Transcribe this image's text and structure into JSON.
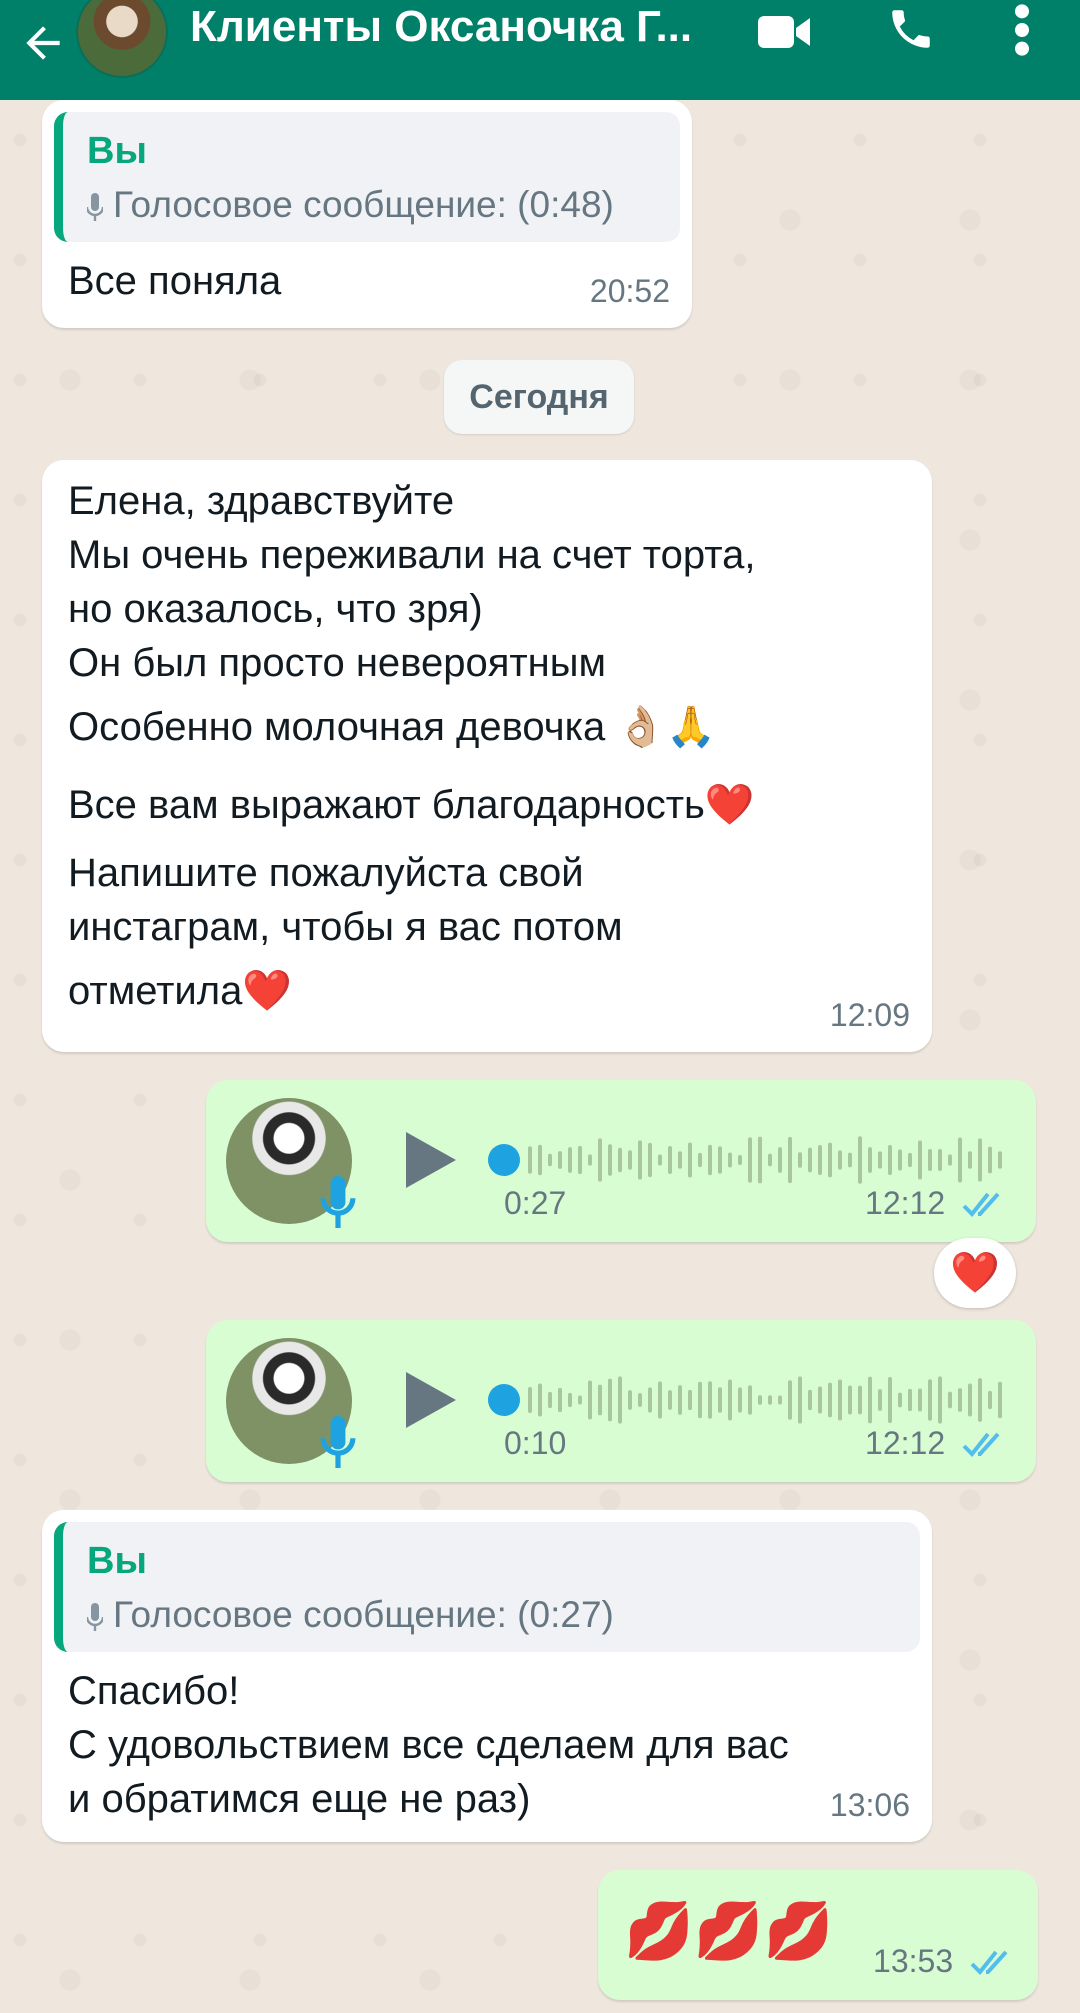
{
  "header": {
    "title": "Клиенты Оксаночка Г...",
    "back_icon": "arrow-left-icon",
    "video_icon": "video-camera-icon",
    "call_icon": "phone-icon",
    "menu_icon": "more-vertical-icon"
  },
  "colors": {
    "header": "#008069",
    "incoming_bubble": "#ffffff",
    "outgoing_bubble": "#d9fdd3",
    "accent_green": "#06a77d",
    "read_ticks": "#53bdeb"
  },
  "messages": {
    "m1": {
      "quote_author": "Вы",
      "quote_text": "Голосовое сообщение: (0:48)",
      "text": "Все поняла",
      "time": "20:52"
    },
    "date_divider": "Сегодня",
    "m2": {
      "lines": [
        "Елена, здравствуйте",
        "Мы очень переживали на счет торта,",
        "но оказалось, что зря)",
        "Он был просто невероятным",
        "Особенно молочная девочка 👌🏼🙏",
        "Все вам выражают благодарность❤️",
        "Напишите пожалуйста свой",
        "инстаграм, чтобы я вас потом",
        "отметила❤️"
      ],
      "time": "12:09"
    },
    "voice1": {
      "duration": "0:27",
      "time": "12:12",
      "reaction": "❤️"
    },
    "voice2": {
      "duration": "0:10",
      "time": "12:12"
    },
    "m3": {
      "quote_author": "Вы",
      "quote_text": "Голосовое сообщение: (0:27)",
      "lines": [
        "Спасибо!",
        "С удовольствием все сделаем для вас",
        "и обратимся еще не раз)"
      ],
      "time": "13:06"
    },
    "m4": {
      "text": "💋💋💋",
      "time": "13:53"
    }
  }
}
